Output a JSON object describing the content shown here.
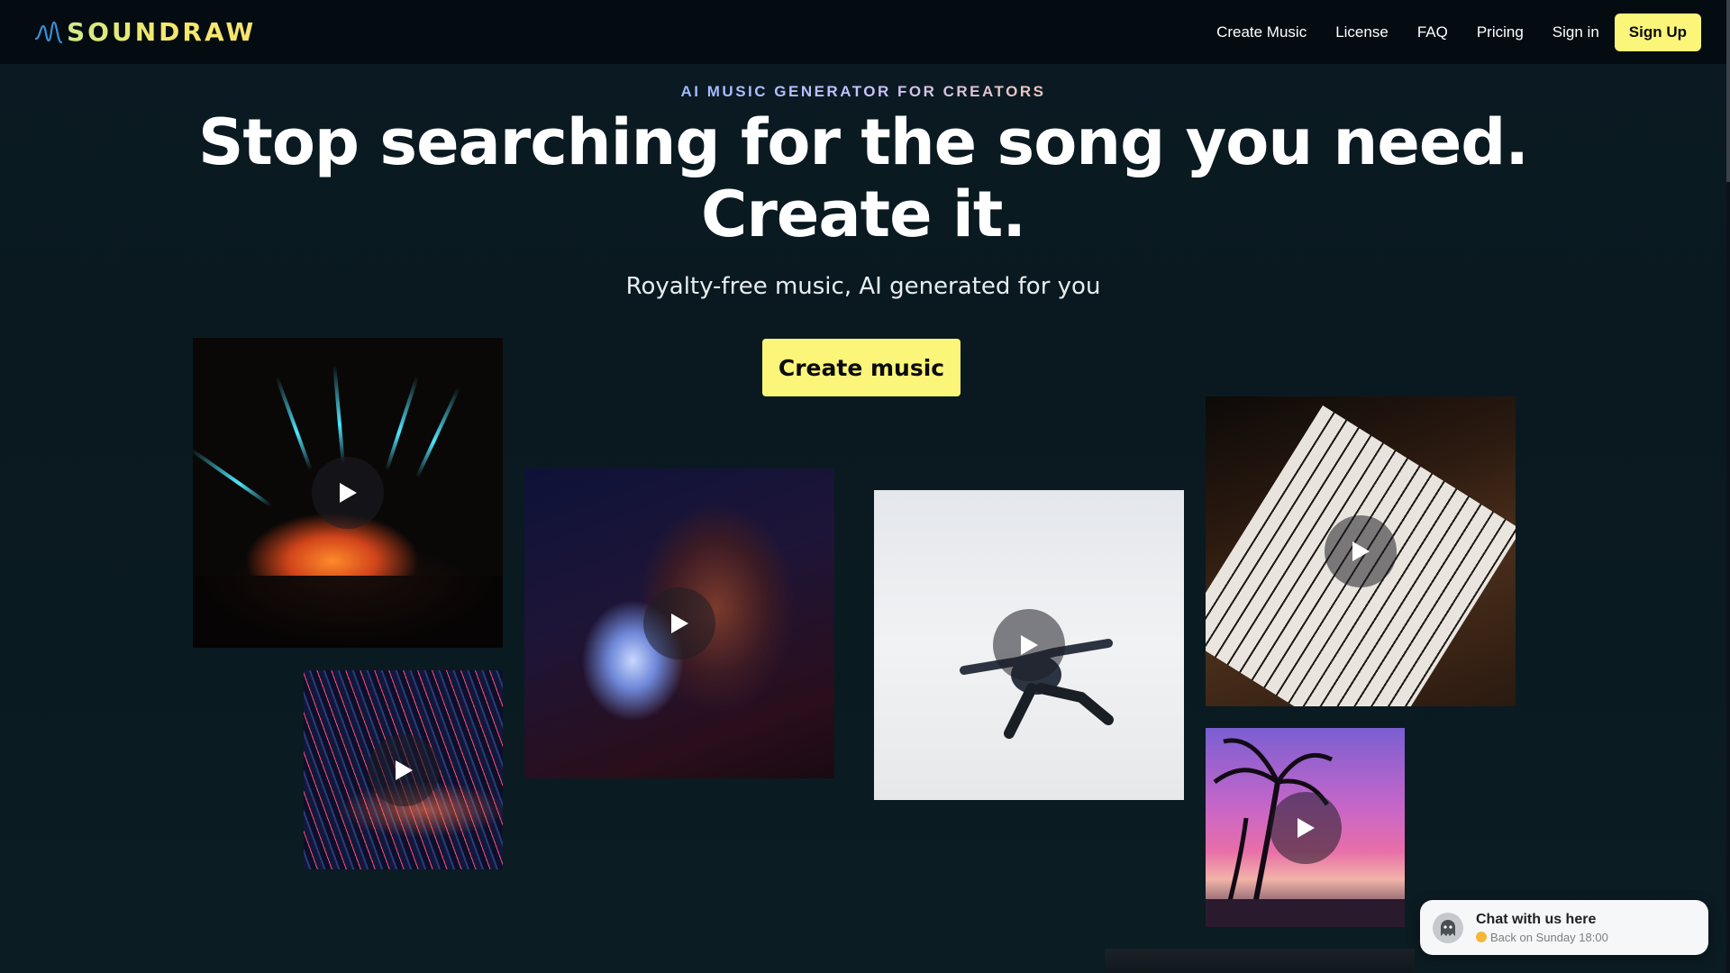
{
  "header": {
    "logo_text": "SOUNDRAW",
    "nav": [
      "Create Music",
      "License",
      "FAQ",
      "Pricing",
      "Sign in"
    ],
    "signup_label": "Sign Up"
  },
  "hero": {
    "eyebrow": "AI MUSIC GENERATOR FOR CREATORS",
    "headline_line1": "Stop searching for the song you need.",
    "headline_line2": "Create it.",
    "subhead": "Royalty-free music, AI generated for you",
    "cta_label": "Create music"
  },
  "tiles": [
    {
      "name": "concert-lights-tile",
      "icon": "play-icon"
    },
    {
      "name": "disco-ball-tile",
      "icon": "play-icon"
    },
    {
      "name": "dancer-tile",
      "icon": "play-icon"
    },
    {
      "name": "piano-tile",
      "icon": "play-icon"
    },
    {
      "name": "city-night-tile",
      "icon": "play-icon"
    },
    {
      "name": "palm-sunset-tile",
      "icon": "play-icon"
    },
    {
      "name": "partial-tile"
    }
  ],
  "chat": {
    "title": "Chat with us here",
    "status": "Back on Sunday 18:00",
    "status_color": "#f4b73a"
  },
  "colors": {
    "accent": "#fbf57a",
    "header_bg": "#040c12",
    "page_bg": "#0b1a22"
  }
}
